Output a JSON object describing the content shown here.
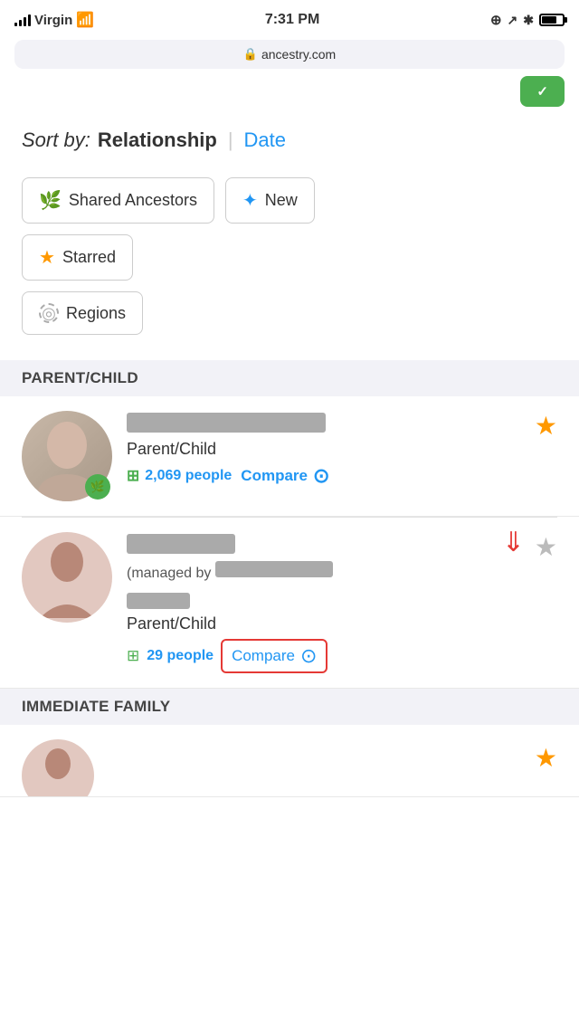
{
  "statusBar": {
    "carrier": "Virgin",
    "time": "7:31 PM",
    "url": "ancestry.com"
  },
  "sortBar": {
    "label": "Sort by:",
    "activeSort": "Relationship",
    "divider": "|",
    "inactiveSort": "Date"
  },
  "filters": [
    {
      "id": "shared-ancestors",
      "label": "Shared Ancestors",
      "iconType": "leaf",
      "iconColor": "green"
    },
    {
      "id": "new",
      "label": "New",
      "iconType": "dna",
      "iconColor": "blue"
    },
    {
      "id": "starred",
      "label": "Starred",
      "iconType": "star",
      "iconColor": "orange"
    },
    {
      "id": "regions",
      "label": "Regions",
      "iconType": "globe",
      "iconColor": "dashed"
    }
  ],
  "sections": [
    {
      "id": "parent-child",
      "label": "PARENT/CHILD",
      "matches": [
        {
          "id": "match-1",
          "relationship": "Parent/Child",
          "people": "2,069 people",
          "starred": true,
          "hasPhoto": true,
          "hasBadge": true,
          "compareText": "Compare",
          "compareHighlighted": false
        },
        {
          "id": "match-2",
          "relationship": "Parent/Child",
          "people": "29 people",
          "starred": false,
          "hasPhoto": false,
          "hasBadge": false,
          "managedBy": true,
          "compareText": "Compare",
          "compareHighlighted": true
        }
      ]
    },
    {
      "id": "immediate-family",
      "label": "IMMEDIATE FAMILY",
      "matches": []
    }
  ],
  "icons": {
    "leaf": "🌿",
    "star": "★",
    "starEmpty": "☆",
    "globe": "◎",
    "dna": "✦",
    "compare": "⊙",
    "lock": "🔒",
    "people": "👥"
  }
}
